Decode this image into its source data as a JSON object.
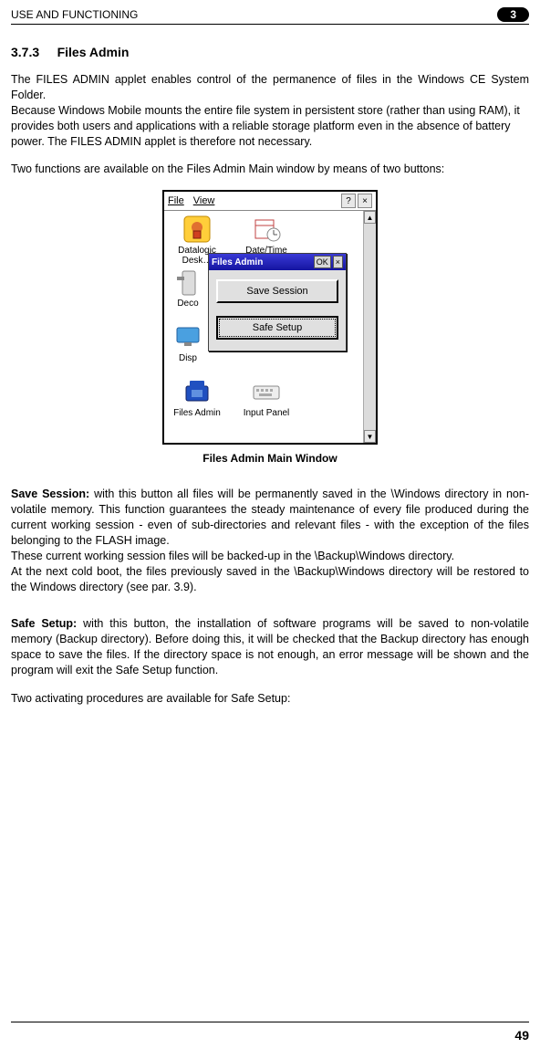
{
  "header": {
    "running_title": "USE AND FUNCTIONING",
    "chapter_badge": "3"
  },
  "section": {
    "number": "3.7.3",
    "title": "Files Admin"
  },
  "paragraphs": {
    "p1": "The FILES ADMIN applet enables control of the permanence of files in the Windows CE System Folder.",
    "p2": "Because Windows Mobile mounts the entire file system in persistent store (rather than using RAM), it provides both users and applications with a reliable storage platform even in the absence of battery power. The FILES ADMIN applet is therefore not necessary.",
    "p3": "Two functions are available on the Files Admin Main window by means of two buttons:",
    "save_label": "Save Session:",
    "save_body": " with this button all files will be permanently saved in the \\Windows directory in non-volatile memory. This function guarantees the steady maintenance of every file produced during the current working session - even of sub-directories and relevant files - with the exception of the files belonging to the FLASH image.",
    "save_body2": "These current working session files will be backed-up in the \\Backup\\Windows directory.",
    "save_body3": "At the next cold boot, the files previously saved in the \\Backup\\Windows directory will be restored to the Windows directory (see par. 3.9).",
    "safe_label": "Safe Setup:",
    "safe_body": " with this button, the installation of software programs will be saved to non-volatile memory (Backup directory). Before doing this, it will be checked that the Backup directory has enough space to save the files. If the directory space is not enough, an error message will be shown and the program will exit the Safe Setup function.",
    "safe_body2": "Two activating procedures are available for Safe Setup:"
  },
  "screenshot": {
    "menu_file": "File",
    "menu_view": "View",
    "help_btn": "?",
    "close_btn": "×",
    "scroll_up": "▲",
    "scroll_down": "▼",
    "icons": {
      "datalogic": "Datalogic Desk…",
      "datetime": "Date/Time",
      "deco": "Deco",
      "disp": "Disp",
      "filesadmin": "Files Admin",
      "inputpanel": "Input Panel"
    },
    "dialog": {
      "title": "Files Admin",
      "ok": "OK",
      "close": "×",
      "btn_save": "Save Session",
      "btn_safe": "Safe Setup"
    }
  },
  "caption": "Files Admin Main Window",
  "page_number": "49"
}
